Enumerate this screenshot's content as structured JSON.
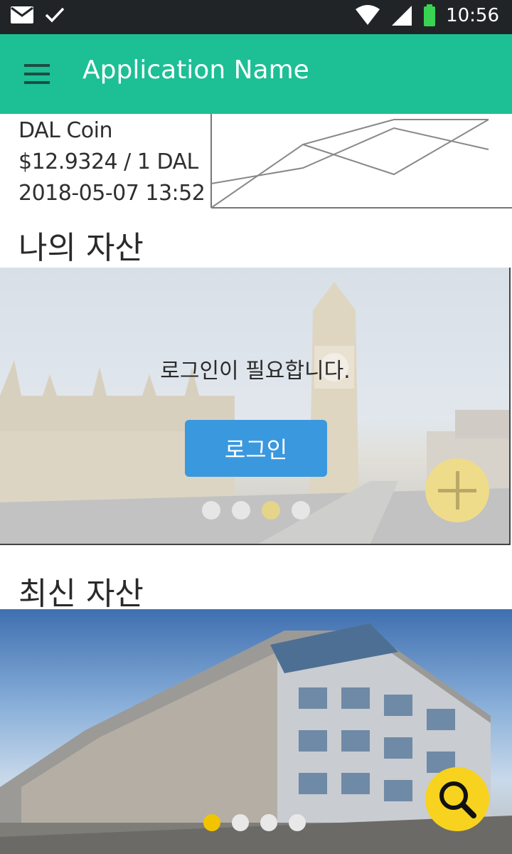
{
  "status_bar": {
    "time": "10:56",
    "icons": [
      "mail-icon",
      "check-icon",
      "wifi-icon",
      "signal-icon",
      "battery-icon"
    ],
    "battery_color": "#39d353"
  },
  "app_bar": {
    "title": "Application Name",
    "color": "#1dbf95"
  },
  "coin": {
    "name": "DAL Coin",
    "price": "$12.9324 / 1 DAL",
    "datetime": "2018-05-07 13:52"
  },
  "my_assets": {
    "title": "나의 자산",
    "message": "로그인이 필요합니다.",
    "login_label": "로그인",
    "dots_count": 4,
    "active_dot": 2,
    "add_button_color": "#eedc8a"
  },
  "latest_assets": {
    "title": "최신 자산",
    "dots_count": 4,
    "active_dot": 0,
    "search_button_color": "#f7d21f"
  },
  "colors": {
    "accent": "#1dbf95",
    "login_button": "#3a98df"
  }
}
